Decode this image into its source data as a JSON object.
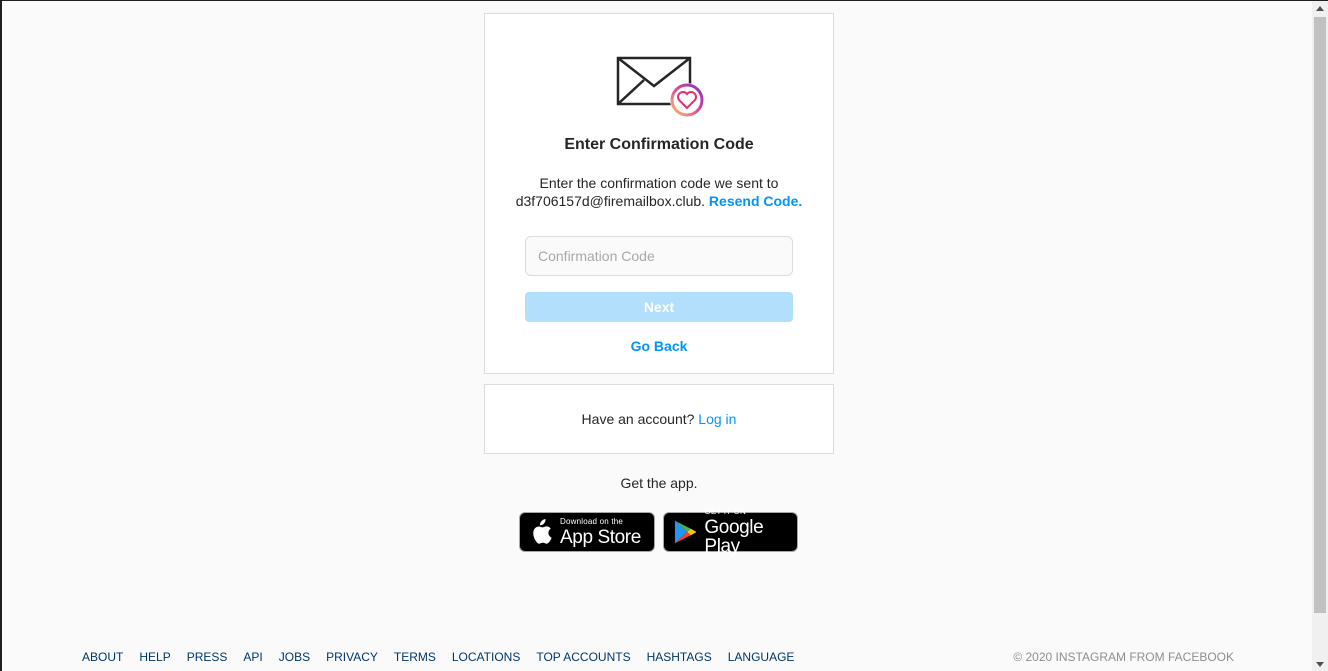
{
  "confirm": {
    "title": "Enter Confirmation Code",
    "desc_line1": "Enter the confirmation code we sent to",
    "email": "d3f706157d@firemailbox.club.",
    "resend": "Resend Code.",
    "input_placeholder": "Confirmation Code",
    "next_label": "Next",
    "go_back": "Go Back"
  },
  "login": {
    "prompt": "Have an account?",
    "link": "Log in"
  },
  "app": {
    "get_app": "Get the app.",
    "appstore_small": "Download on the",
    "appstore_big": "App Store",
    "googleplay_small": "GET IT ON",
    "googleplay_big": "Google Play"
  },
  "footer": {
    "links": [
      "About",
      "Help",
      "Press",
      "API",
      "Jobs",
      "Privacy",
      "Terms",
      "Locations",
      "Top Accounts",
      "Hashtags",
      "Language"
    ],
    "copyright": "© 2020 Instagram from Facebook"
  },
  "colors": {
    "accent": "#0095f6",
    "next_disabled": "#b2dffc"
  },
  "icons": {
    "mail": "mail-heart-icon",
    "apple": "apple-icon",
    "play": "google-play-icon"
  }
}
